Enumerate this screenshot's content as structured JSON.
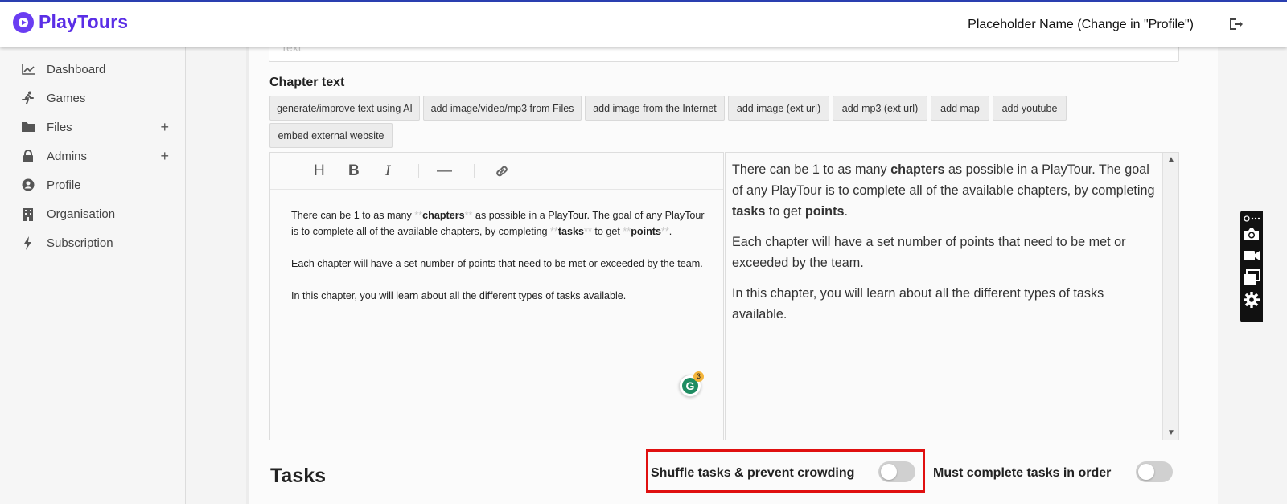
{
  "app": {
    "brand": "PlayTours",
    "user_name": "Placeholder Name (Change in \"Profile\")"
  },
  "colors": {
    "brand": "#5a2ee6",
    "accent_border": "#2a3fb0",
    "highlight": "#e01010"
  },
  "sidebar": {
    "items": [
      {
        "label": "Dashboard",
        "icon": "chart-icon"
      },
      {
        "label": "Games",
        "icon": "running-icon"
      },
      {
        "label": "Files",
        "icon": "folder-icon",
        "plus": "+"
      },
      {
        "label": "Admins",
        "icon": "lock-icon",
        "plus": "+"
      },
      {
        "label": "Profile",
        "icon": "user-circle-icon"
      },
      {
        "label": "Organisation",
        "icon": "building-icon"
      },
      {
        "label": "Subscription",
        "icon": "bolt-icon"
      }
    ]
  },
  "form": {
    "top_input_placeholder": "Text",
    "chapter_text_label": "Chapter text",
    "toolbar_buttons": [
      "generate/improve text using AI",
      "add image/video/mp3 from Files",
      "add image from the Internet",
      "add image (ext url)",
      "add mp3 (ext url)",
      "add map",
      "add youtube",
      "embed external website"
    ]
  },
  "editor": {
    "tools": [
      "H",
      "B",
      "I",
      "—"
    ],
    "p1": {
      "a": "There can be 1 to as many ",
      "m1": "**",
      "b1": "chapters",
      "m2": "**",
      "c": " as possible in a PlayTour. The goal of any PlayTour is to complete all of the available chapters, by completing ",
      "m3": "**",
      "b2": "tasks",
      "m4": "**",
      "d": " to get ",
      "m5": "**",
      "b3": "points",
      "m6": "**",
      "e": "."
    },
    "p2": "Each chapter will have a set number of points that need to be met or exceeded by the team.",
    "p3": "In this chapter, you will learn about all the different types of tasks available.",
    "grammarly_count": "3"
  },
  "preview": {
    "p1": {
      "a": "There can be 1 to as many ",
      "b1": "chapters",
      "c": " as possible in a PlayTour. The goal of any PlayTour is to complete all of the available chapters, by completing ",
      "b2": "tasks",
      "d": " to get ",
      "b3": "points",
      "e": "."
    },
    "p2": "Each chapter will have a set number of points that need to be met or exceeded by the team.",
    "p3": "In this chapter, you will learn about all the different types of tasks available."
  },
  "tasks": {
    "title": "Tasks",
    "shuffle_label": "Shuffle tasks & prevent crowding",
    "shuffle_on": false,
    "order_label": "Must complete tasks in order",
    "order_on": false
  }
}
